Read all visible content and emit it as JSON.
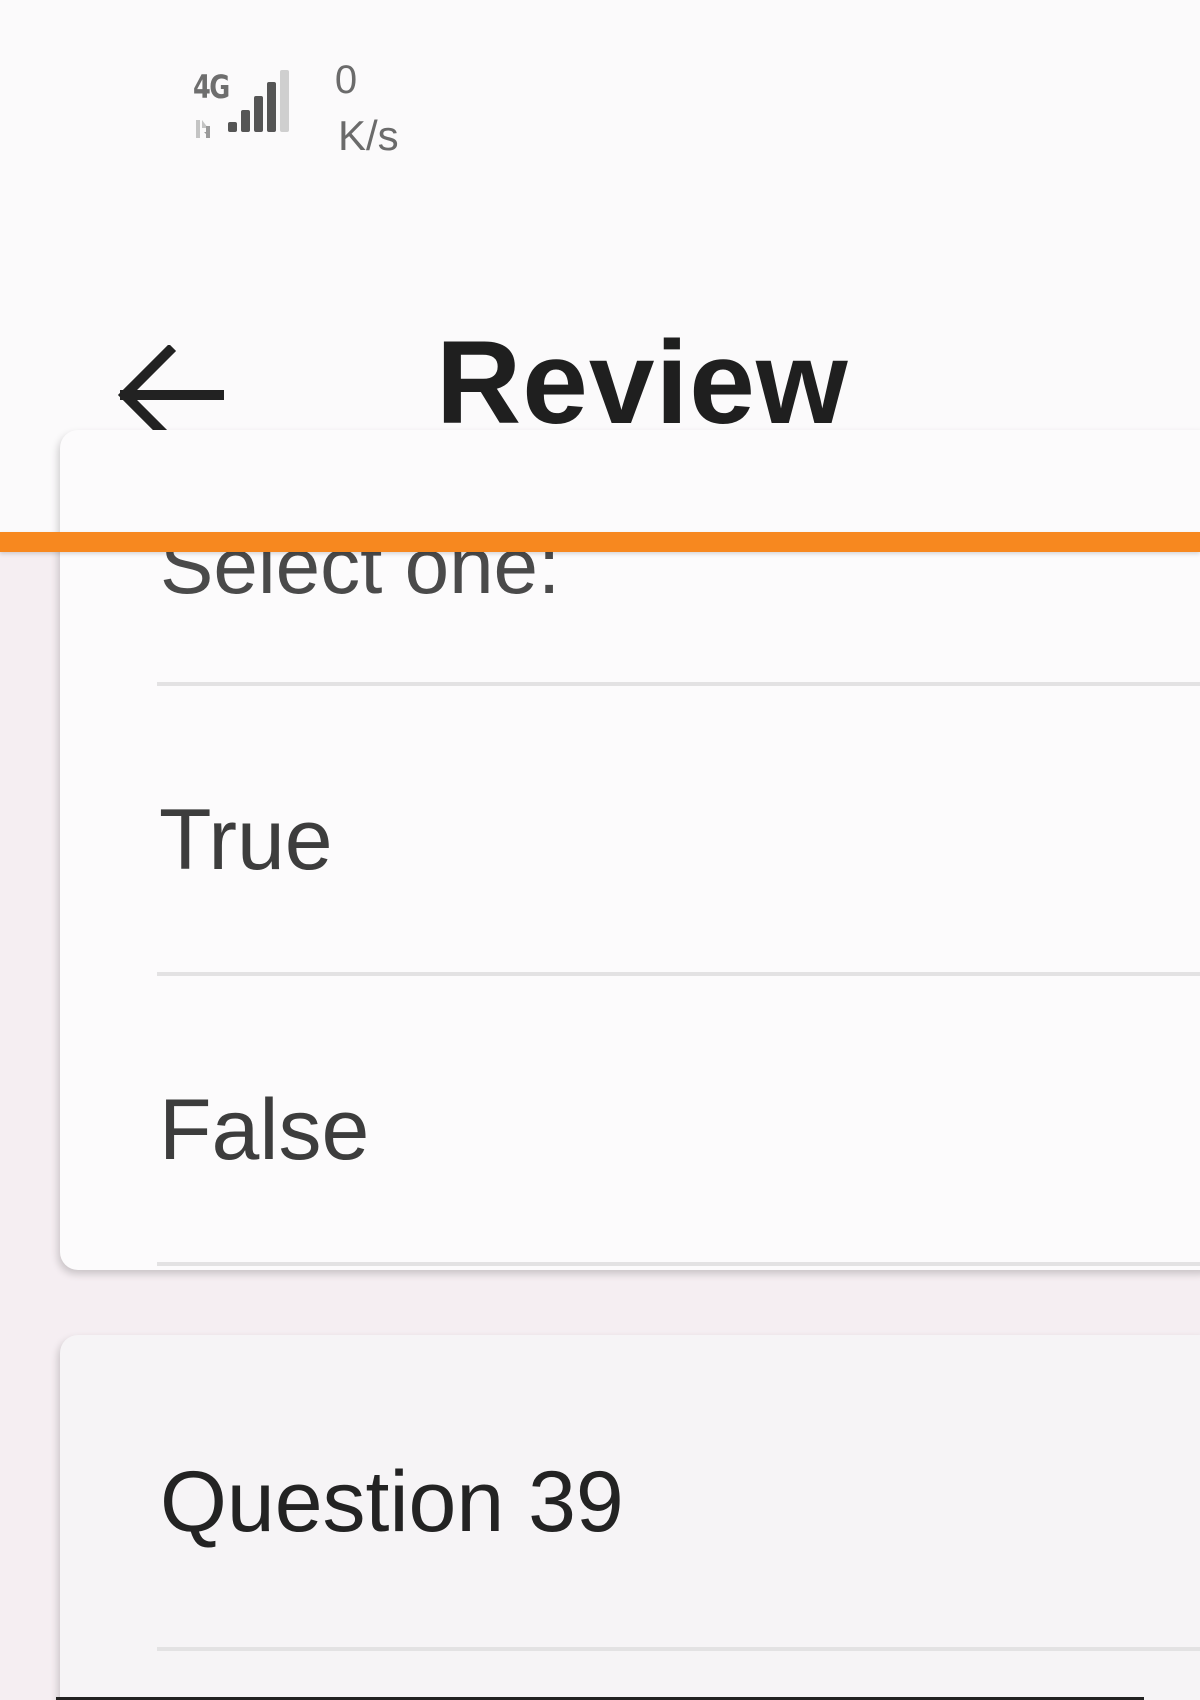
{
  "status_bar": {
    "network_type": "4G",
    "speed_value": "0",
    "speed_unit": "K/s",
    "icons": [
      "data-activity-icon",
      "signal-strength-icon"
    ]
  },
  "app_bar": {
    "title": "Review",
    "back_icon": "arrow-left-icon"
  },
  "progress": {
    "color": "#f7881f"
  },
  "answer_card": {
    "prompt": "Select one:",
    "options": [
      {
        "label": "True"
      },
      {
        "label": "False"
      }
    ]
  },
  "next_card": {
    "title": "Question 39"
  }
}
